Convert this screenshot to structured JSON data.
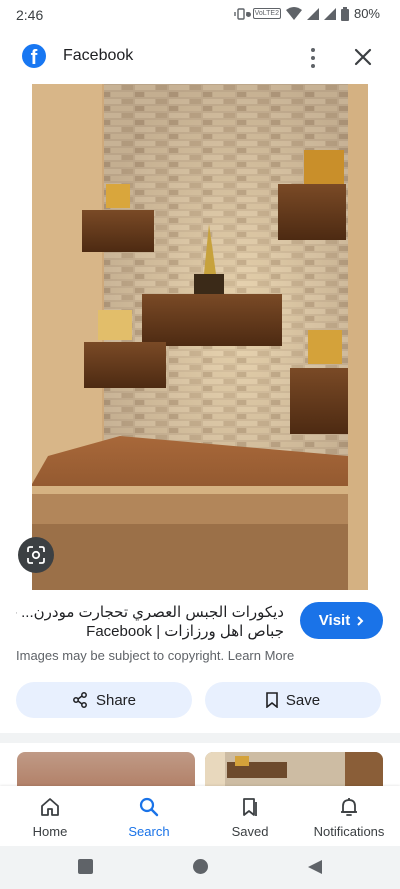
{
  "status_bar": {
    "time": "2:46",
    "network": "VoLTE2",
    "battery": "80%"
  },
  "header": {
    "site_name": "Facebook"
  },
  "result": {
    "title_line1": "ديكورات الجبس العصري تحجارت مودرن... -",
    "title_line2": "جباص اهل ورزازات | Facebook",
    "visit_label": "Visit",
    "copyright_text": "Images may be subject to copyright.",
    "learn_more": "Learn More"
  },
  "actions": {
    "share_label": "Share",
    "save_label": "Save"
  },
  "bottom_nav": {
    "items": [
      {
        "label": "Home",
        "icon": "home-icon"
      },
      {
        "label": "Search",
        "icon": "search-icon",
        "active": true
      },
      {
        "label": "Saved",
        "icon": "saved-icon"
      },
      {
        "label": "Notifications",
        "icon": "bell-icon"
      }
    ]
  },
  "colors": {
    "accent": "#1a73e8",
    "button_tint": "#e8f0fe",
    "facebook": "#1877f2"
  }
}
